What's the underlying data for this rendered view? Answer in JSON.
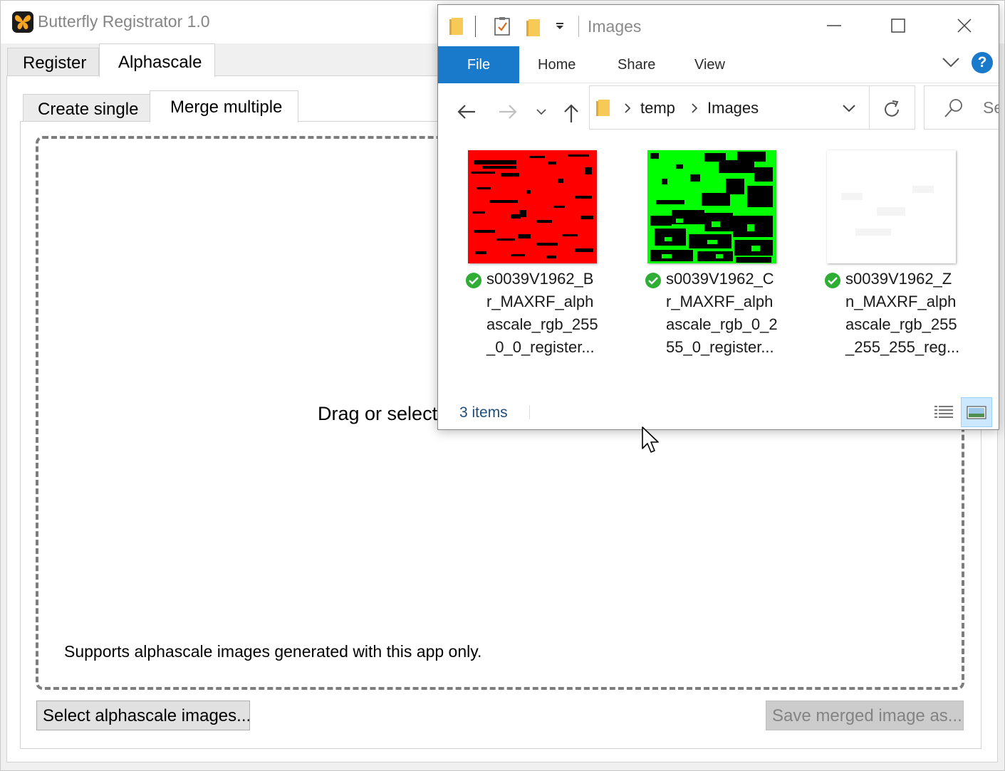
{
  "app": {
    "title": "Butterfly Registrator 1.0",
    "icon": "butterfly-app-icon",
    "tabs": [
      {
        "label": "Register",
        "active": false
      },
      {
        "label": "Alphascale",
        "active": true
      }
    ],
    "subtabs": [
      {
        "label": "Create single",
        "active": false
      },
      {
        "label": "Merge multiple",
        "active": true
      }
    ],
    "dropzone": {
      "text": "Drag or select",
      "note": "Supports alphascale images generated with this app only."
    },
    "buttons": {
      "select": "Select alphascale images...",
      "save": "Save merged image as...",
      "save_enabled": false
    }
  },
  "explorer": {
    "title": "Images",
    "quick_access_icons": [
      "folder-icon",
      "properties-icon",
      "new-folder-icon",
      "customize-dropdown-icon"
    ],
    "ribbon_tabs": [
      "File",
      "Home",
      "Share",
      "View"
    ],
    "active_ribbon_tab": "File",
    "path": [
      "temp",
      "Images"
    ],
    "search_placeholder": "Se",
    "files": [
      {
        "line1": "s0039V1962_B",
        "line2": "r_MAXRF_alph",
        "line3": "ascale_rgb_255",
        "line4": "_0_0_register...",
        "thumb_color": "#ff0000",
        "status": "synced"
      },
      {
        "line1": "s0039V1962_C",
        "line2": "r_MAXRF_alph",
        "line3": "ascale_rgb_0_2",
        "line4": "55_0_register...",
        "thumb_color": "#00ff00",
        "status": "synced"
      },
      {
        "line1": "s0039V1962_Z",
        "line2": "n_MAXRF_alph",
        "line3": "ascale_rgb_255",
        "line4": "_255_255_reg...",
        "thumb_color": "#ffffff",
        "status": "synced"
      }
    ],
    "status": {
      "item_count": "3 items"
    },
    "view_mode": "large-icons"
  },
  "colors": {
    "accent": "#1979ca",
    "sync_green": "#2eae34",
    "dropzone_border": "#7d7d7d"
  }
}
